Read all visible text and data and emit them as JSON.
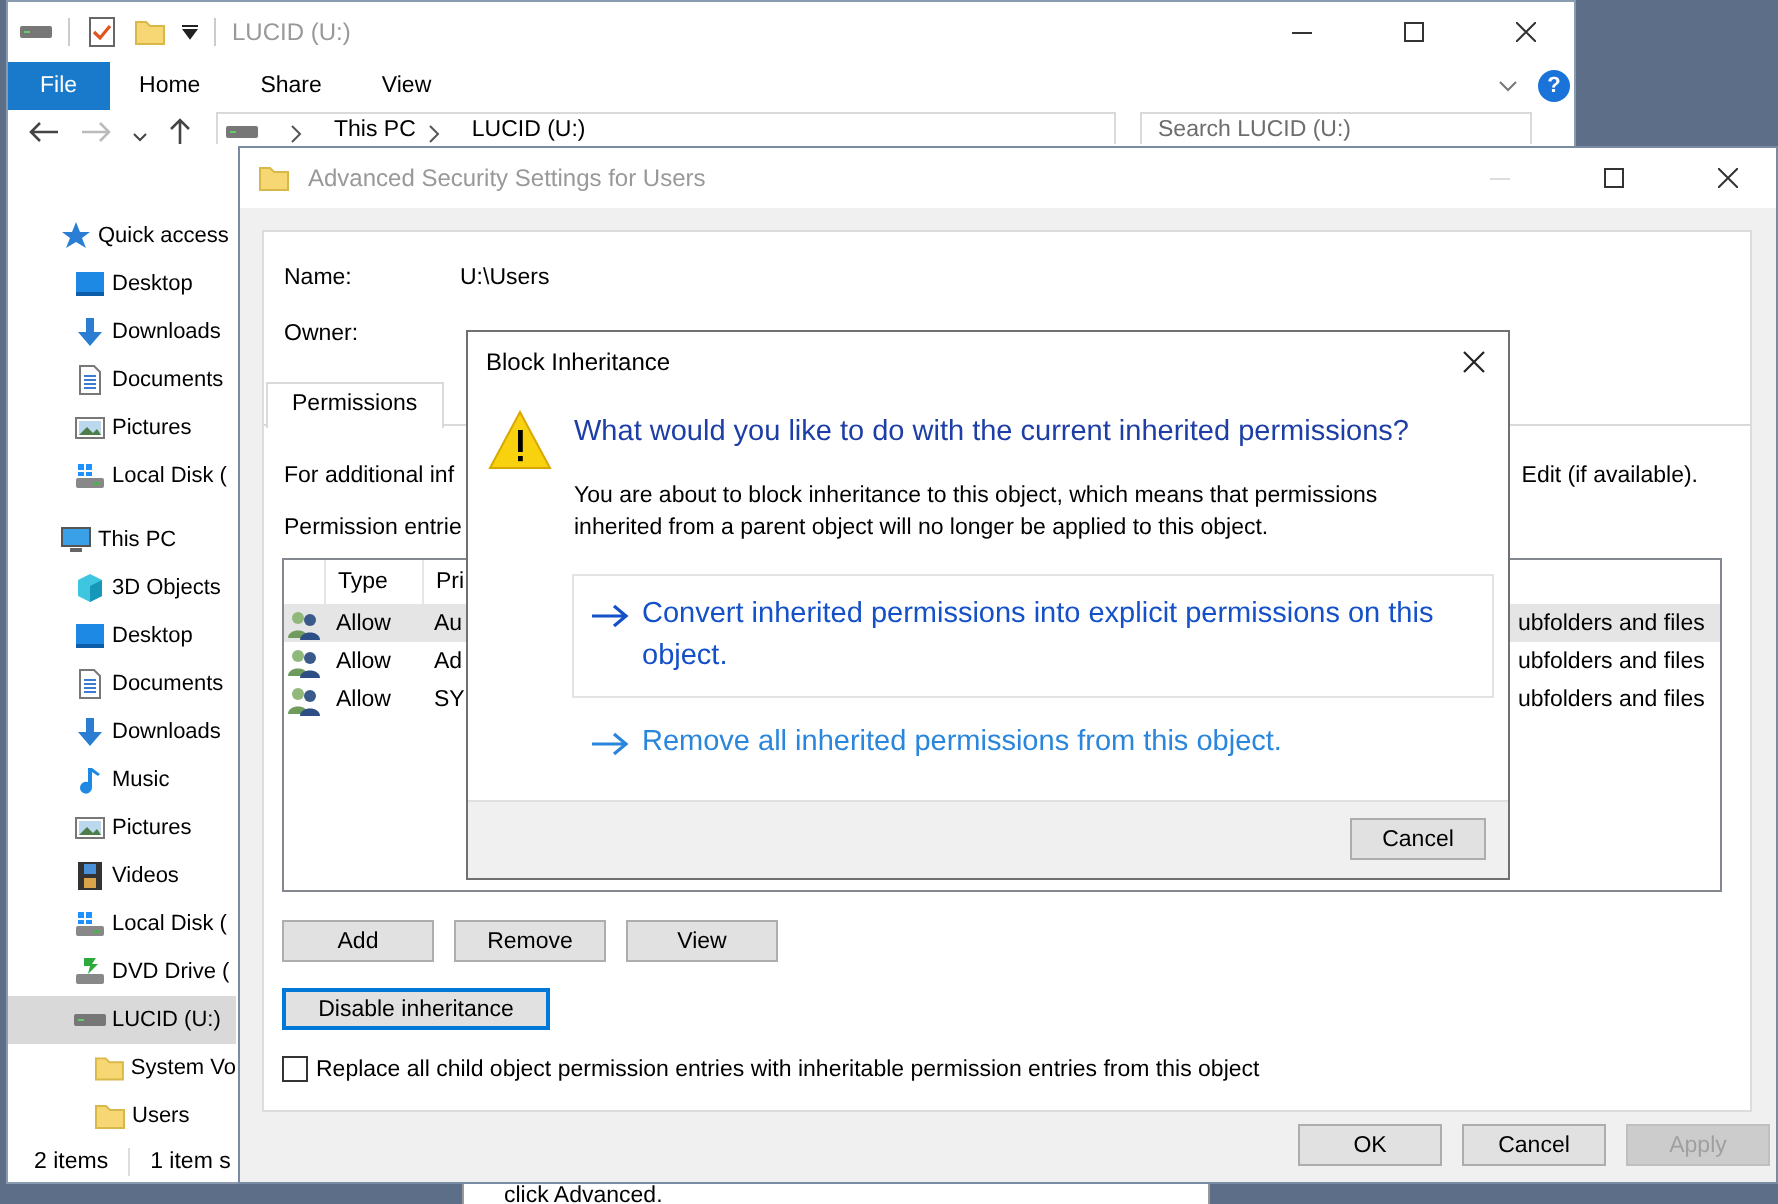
{
  "explorer": {
    "title": "LUCID (U:)",
    "ribbon_tabs": [
      {
        "label": "File",
        "kind": "menu",
        "selected": false
      },
      {
        "label": "Home",
        "kind": "tab",
        "selected": false
      },
      {
        "label": "Share",
        "kind": "tab",
        "selected": false
      },
      {
        "label": "View",
        "kind": "tab",
        "selected": false
      }
    ],
    "help": "?",
    "address": [
      "This PC",
      "LUCID (U:)"
    ],
    "search": {
      "placeholder": "Search LUCID (U:)"
    },
    "sidebar": {
      "items": [
        {
          "label": "Quick access",
          "kind": "star",
          "selected": false,
          "children": [
            {
              "label": "Desktop",
              "kind": "desktop",
              "selected": false
            },
            {
              "label": "Downloads",
              "kind": "download",
              "selected": false
            },
            {
              "label": "Documents",
              "kind": "document",
              "selected": false
            },
            {
              "label": "Pictures",
              "kind": "picture",
              "selected": false
            },
            {
              "label": "Local Disk (",
              "kind": "disk",
              "selected": false
            }
          ]
        },
        {
          "label": "This PC",
          "kind": "pc",
          "selected": false,
          "children": [
            {
              "label": "3D Objects",
              "kind": "cube",
              "selected": false
            },
            {
              "label": "Desktop",
              "kind": "desktop",
              "selected": false
            },
            {
              "label": "Documents",
              "kind": "document",
              "selected": false
            },
            {
              "label": "Downloads",
              "kind": "download",
              "selected": false
            },
            {
              "label": "Music",
              "kind": "music",
              "selected": false
            },
            {
              "label": "Pictures",
              "kind": "picture",
              "selected": false
            },
            {
              "label": "Videos",
              "kind": "video",
              "selected": false
            },
            {
              "label": "Local Disk (",
              "kind": "disk",
              "selected": false
            },
            {
              "label": "DVD Drive (",
              "kind": "dvd",
              "selected": false
            },
            {
              "label": "LUCID (U:)",
              "kind": "drive",
              "selected": true,
              "children": [
                {
                  "label": "System Vo",
                  "kind": "folder",
                  "selected": false
                },
                {
                  "label": "Users",
                  "kind": "folder",
                  "selected": false
                }
              ]
            }
          ]
        }
      ]
    },
    "status_bar": [
      "2 items",
      "1 item s"
    ]
  },
  "background_window": {
    "text": "click Advanced."
  },
  "advanced_security": {
    "title": "Advanced Security Settings for Users",
    "name_label": "Name:",
    "name_value": "U:\\Users",
    "owner_label": "Owner:",
    "tabs": [
      {
        "label": "Permissions",
        "selected": true
      }
    ],
    "info_text": "For additional inf",
    "info_text_end": "Edit (if available).",
    "entries_label": "Permission entrie",
    "columns": [
      "Type",
      "Pri"
    ],
    "rows": [
      {
        "type": "Allow",
        "principal": "Au",
        "column_3": "ubfolders and files",
        "selected": true
      },
      {
        "type": "Allow",
        "principal": "Ad",
        "column_3": "ubfolders and files",
        "selected": false
      },
      {
        "type": "Allow",
        "principal": "SY",
        "column_3": "ubfolders and files",
        "selected": false
      }
    ],
    "entry_buttons": [
      "Add",
      "Remove",
      "View"
    ],
    "disable_inheritance": {
      "label": "Disable inheritance",
      "focused": true
    },
    "replace_checkbox": {
      "label": "Replace all child object permission entries with inheritable permission entries from this object",
      "checked": false
    },
    "buttons": [
      {
        "label": "OK",
        "disabled": false
      },
      {
        "label": "Cancel",
        "disabled": false
      },
      {
        "label": "Apply",
        "disabled": true
      }
    ]
  },
  "block_inheritance": {
    "title": "Block Inheritance",
    "heading": "What would you like to do with the current inherited permissions?",
    "message": "You are about to block inheritance to this object, which means that permissions inherited from a parent object will no longer be applied to this object.",
    "options": [
      {
        "text": "Convert inherited permissions into explicit permissions on this object.",
        "focused": true
      },
      {
        "text": "Remove all inherited permissions from this object.",
        "focused": false
      }
    ],
    "cancel": "Cancel"
  }
}
